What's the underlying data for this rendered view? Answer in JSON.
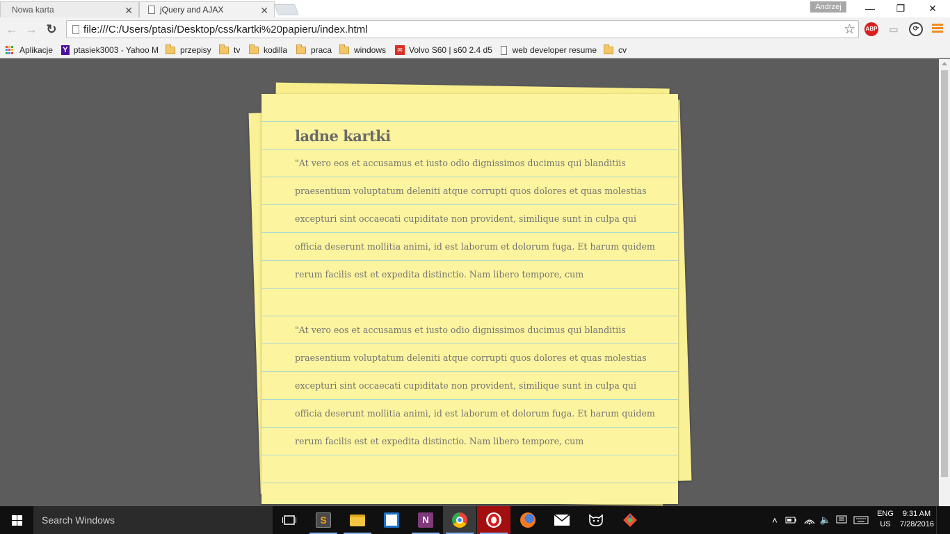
{
  "browser": {
    "tabs": [
      {
        "title": "Nowa karta",
        "active": false
      },
      {
        "title": "jQuery and AJAX",
        "active": true
      }
    ],
    "profile_name": "Andrzej",
    "address": "file:///C:/Users/ptasi/Desktop/css/kartki%20papieru/index.html",
    "extensions": {
      "abp_label": "ABP"
    },
    "menu_icon_color": "#f08a24"
  },
  "bookmarks": [
    {
      "label": "Aplikacje",
      "icon": "apps-icon"
    },
    {
      "label": "ptasiek3003 - Yahoo M",
      "icon": "yahoo-icon"
    },
    {
      "label": "przepisy",
      "icon": "folder-icon"
    },
    {
      "label": "tv",
      "icon": "folder-icon"
    },
    {
      "label": "kodilla",
      "icon": "folder-icon"
    },
    {
      "label": "praca",
      "icon": "folder-icon"
    },
    {
      "label": "windows",
      "icon": "folder-icon"
    },
    {
      "label": "Volvo S60 | s60 2.4 d5",
      "icon": "gmail-icon"
    },
    {
      "label": "web developer resume",
      "icon": "page-icon"
    },
    {
      "label": "cv",
      "icon": "folder-icon"
    }
  ],
  "note": {
    "title": "ladne kartki",
    "paragraphs": [
      "\"At vero eos et accusamus et iusto odio dignissimos ducimus qui blanditiis praesentium voluptatum deleniti atque corrupti quos dolores et quas molestias excepturi sint occaecati cupiditate non provident, similique sunt in culpa qui officia deserunt mollitia animi, id est laborum et dolorum fuga. Et harum quidem rerum facilis est et expedita distinctio. Nam libero tempore, cum",
      "\"At vero eos et accusamus et iusto odio dignissimos ducimus qui blanditiis praesentium voluptatum deleniti atque corrupti quos dolores et quas molestias excepturi sint occaecati cupiditate non provident, similique sunt in culpa qui officia deserunt mollitia animi, id est laborum et dolorum fuga. Et harum quidem rerum facilis est et expedita distinctio. Nam libero tempore, cum"
    ],
    "paper_color": "#fcf49e",
    "line_color": "#a9d7d4"
  },
  "taskbar": {
    "search_placeholder": "Search Windows",
    "language": {
      "line1": "ENG",
      "line2": "US"
    },
    "clock": {
      "time": "9:31 AM",
      "date": "7/28/2016"
    },
    "apps": [
      "task-view-icon",
      "sublime-icon",
      "file-explorer-icon",
      "visual-studio-icon",
      "onenote-icon",
      "chrome-icon",
      "opera-icon",
      "firefox-icon",
      "mail-icon",
      "github-icon",
      "git-icon"
    ]
  }
}
